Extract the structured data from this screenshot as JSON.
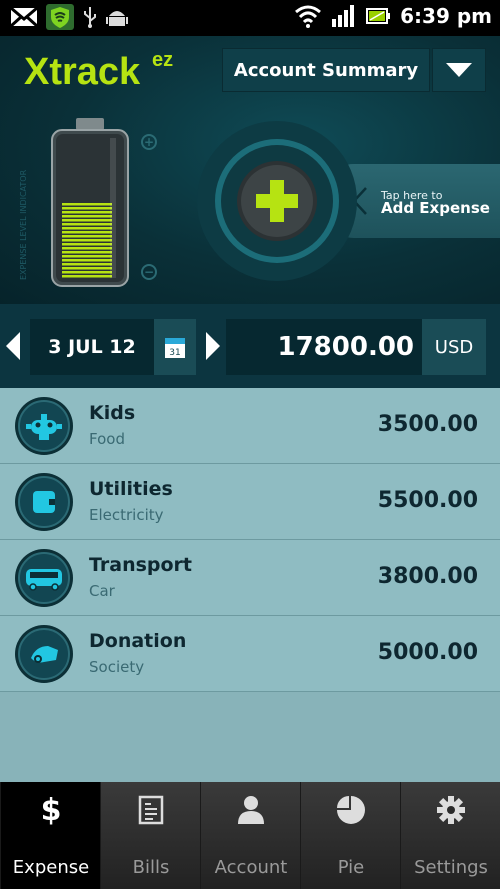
{
  "status_bar": {
    "time": "6:39 pm",
    "icons": [
      "gmail-icon",
      "shield-icon",
      "usb-icon",
      "android-icon",
      "wifi-icon",
      "signal-icon",
      "battery-icon"
    ]
  },
  "header": {
    "logo_main": "Xtrack",
    "logo_sup": "ez",
    "account_button_label": "Account Summary",
    "indicator_label": "EXPENSE LEVEL INDICATOR",
    "battery_level": 0.55,
    "add_hint_small": "Tap here to",
    "add_hint_big": "Add Expense"
  },
  "date_bar": {
    "date": "3 JUL 12",
    "calendar_day": "31",
    "amount": "17800.00",
    "currency": "USD"
  },
  "expenses": [
    {
      "title": "Kids",
      "subtitle": "Food",
      "amount": "3500.00",
      "icon": "kids-robot-icon"
    },
    {
      "title": "Utilities",
      "subtitle": "Electricity",
      "amount": "5500.00",
      "icon": "utilities-plug-icon"
    },
    {
      "title": "Transport",
      "subtitle": "Car",
      "amount": "3800.00",
      "icon": "transport-bus-icon"
    },
    {
      "title": "Donation",
      "subtitle": "Society",
      "amount": "5000.00",
      "icon": "donation-hand-icon"
    }
  ],
  "tabs": [
    {
      "label": "Expense",
      "icon_glyph": "$",
      "active": true
    },
    {
      "label": "Bills",
      "active": false
    },
    {
      "label": "Account",
      "active": false
    },
    {
      "label": "Pie",
      "active": false
    },
    {
      "label": "Settings",
      "active": false
    }
  ],
  "colors": {
    "accent_green": "#b6e312",
    "header_bg": "#0a3038",
    "list_bg": "#8fbcc2",
    "icon_cyan": "#22c7e2"
  }
}
